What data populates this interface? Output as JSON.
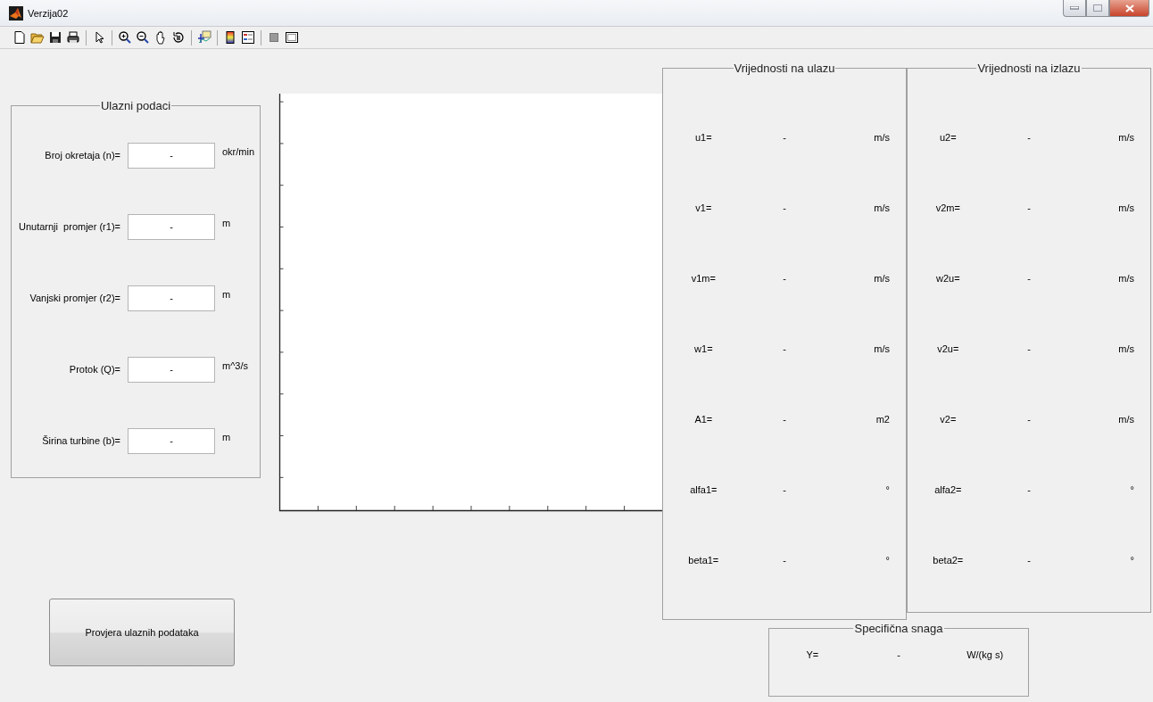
{
  "window": {
    "title": "Verzija02"
  },
  "input_panel": {
    "title": "Ulazni podaci",
    "fields": [
      {
        "label": "Broj okretaja (n)=",
        "value": "-",
        "unit": "okr/min"
      },
      {
        "label": "Unutarnji  promjer (r1)=",
        "value": "-",
        "unit": "m"
      },
      {
        "label": "Vanjski promjer (r2)=",
        "value": "-",
        "unit": "m"
      },
      {
        "label": "Protok (Q)=",
        "value": "-",
        "unit": "m^3/s"
      },
      {
        "label": "Širina turbine (b)=",
        "value": "-",
        "unit": "m"
      }
    ]
  },
  "check_button": {
    "label": "Provjera ulaznih podataka"
  },
  "inlet_panel": {
    "title": "Vrijednosti na ulazu",
    "rows": [
      {
        "label": "u1=",
        "value": "-",
        "unit": "m/s"
      },
      {
        "label": "v1=",
        "value": "-",
        "unit": "m/s"
      },
      {
        "label": "v1m=",
        "value": "-",
        "unit": "m/s"
      },
      {
        "label": "w1=",
        "value": "-",
        "unit": "m/s"
      },
      {
        "label": "A1=",
        "value": "-",
        "unit": "m2"
      },
      {
        "label": "alfa1=",
        "value": "-",
        "unit": "°"
      },
      {
        "label": "beta1=",
        "value": "-",
        "unit": "°"
      }
    ]
  },
  "outlet_panel": {
    "title": "Vrijednosti na izlazu",
    "rows": [
      {
        "label": "u2=",
        "value": "-",
        "unit": "m/s"
      },
      {
        "label": "v2m=",
        "value": "-",
        "unit": "m/s"
      },
      {
        "label": "w2u=",
        "value": "-",
        "unit": "m/s"
      },
      {
        "label": "v2u=",
        "value": "-",
        "unit": "m/s"
      },
      {
        "label": "v2=",
        "value": "-",
        "unit": "m/s"
      },
      {
        "label": "alfa2=",
        "value": "-",
        "unit": "°"
      },
      {
        "label": "beta2=",
        "value": "-",
        "unit": "°"
      }
    ]
  },
  "power_panel": {
    "title": "Specifična snaga",
    "rows": [
      {
        "label": "Y=",
        "value": "-",
        "unit": "W/(kg s)"
      }
    ]
  }
}
